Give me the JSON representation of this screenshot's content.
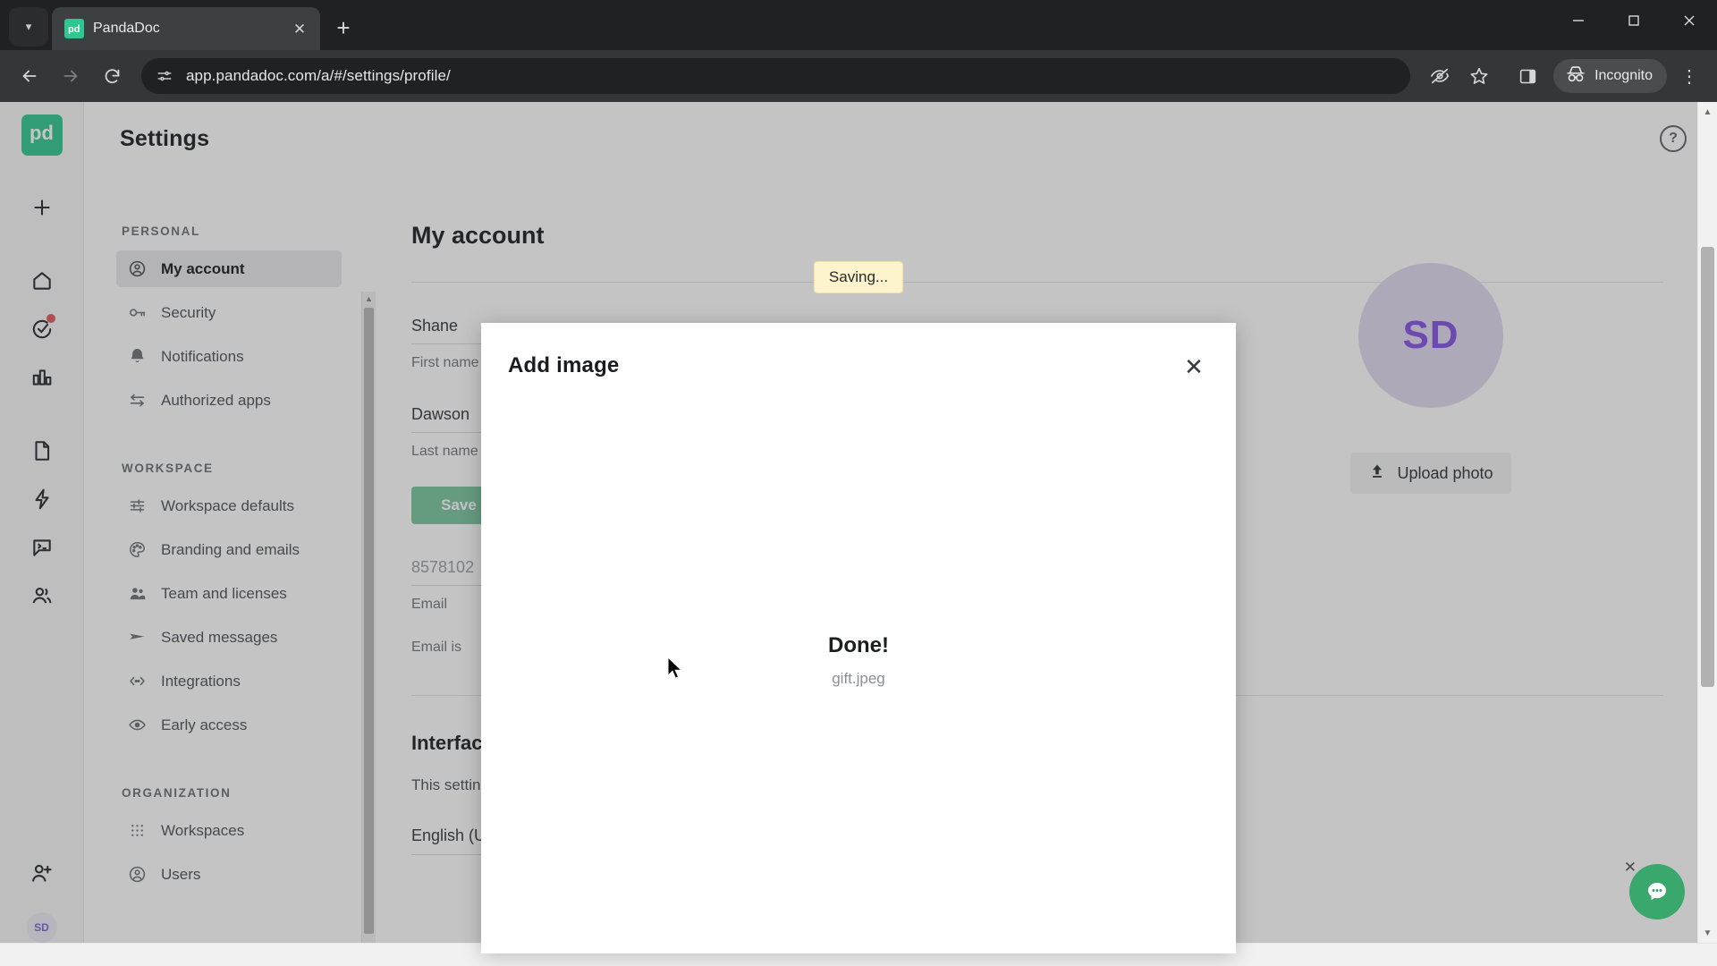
{
  "browser": {
    "tab": {
      "title": "PandaDoc",
      "favicon_label": "pd",
      "close_icon": "close-icon"
    },
    "new_tab_icon": "plus-icon",
    "tab_list_chevron_icon": "chevron-down-icon",
    "window_controls": {
      "minimize": "—",
      "maximize": "❐",
      "close": "✕"
    },
    "nav": {
      "back_icon": "arrow-left-icon",
      "forward_icon": "arrow-right-icon",
      "reload_icon": "reload-icon",
      "site_info_icon": "page-settings-icon"
    },
    "url": "app.pandadoc.com/a/#/settings/profile/",
    "actions": {
      "tracking_protection_icon": "eye-slash-icon",
      "bookmark_icon": "star-icon",
      "side_panel_icon": "side-panel-icon",
      "incognito_label": "Incognito",
      "incognito_icon": "incognito-icon",
      "menu_icon": "kebab-menu-icon"
    }
  },
  "rail": {
    "logo_label": "pd",
    "items": [
      {
        "name": "create-new",
        "icon": "plus-icon"
      },
      {
        "name": "home",
        "icon": "home-icon"
      },
      {
        "name": "tasks",
        "icon": "check-circle-icon",
        "badge": true
      },
      {
        "name": "reports",
        "icon": "bar-chart-icon"
      },
      {
        "name": "documents",
        "icon": "document-icon"
      },
      {
        "name": "quick-actions",
        "icon": "lightning-icon"
      },
      {
        "name": "forms",
        "icon": "form-icon"
      },
      {
        "name": "contacts",
        "icon": "people-icon"
      },
      {
        "name": "invite-users",
        "icon": "person-add-icon"
      }
    ],
    "avatar_initials": "SD"
  },
  "header": {
    "title": "Settings",
    "help_icon": "question-mark-icon",
    "help_label": "?"
  },
  "toast": {
    "text": "Saving..."
  },
  "sidebar": {
    "groups": [
      {
        "label": "PERSONAL",
        "items": [
          {
            "label": "My account",
            "icon": "user-circle-icon",
            "active": true
          },
          {
            "label": "Security",
            "icon": "key-icon",
            "active": false
          },
          {
            "label": "Notifications",
            "icon": "bell-icon",
            "active": false
          },
          {
            "label": "Authorized apps",
            "icon": "transfer-arrows-icon",
            "active": false
          }
        ]
      },
      {
        "label": "WORKSPACE",
        "items": [
          {
            "label": "Workspace defaults",
            "icon": "sliders-icon",
            "active": false
          },
          {
            "label": "Branding and emails",
            "icon": "palette-icon",
            "active": false
          },
          {
            "label": "Team and licenses",
            "icon": "people-icon",
            "active": false
          },
          {
            "label": "Saved messages",
            "icon": "send-icon",
            "active": false
          },
          {
            "label": "Integrations",
            "icon": "code-brackets-icon",
            "active": false
          },
          {
            "label": "Early access",
            "icon": "eye-icon",
            "active": false
          }
        ]
      },
      {
        "label": "ORGANIZATION",
        "items": [
          {
            "label": "Workspaces",
            "icon": "grid-dots-icon",
            "active": false
          },
          {
            "label": "Users",
            "icon": "user-circle-icon",
            "active": false
          }
        ]
      }
    ]
  },
  "main": {
    "page_title": "My account",
    "fields": [
      {
        "value": "Shane",
        "label": "First name"
      },
      {
        "value": "Dawson",
        "label": "Last name"
      }
    ],
    "save_label": "Save",
    "email": {
      "value": "8578102",
      "label": "Email"
    },
    "email_note": "Email is",
    "interface": {
      "heading": "Interface",
      "description": "This setting will update the display language.",
      "language": "English (United States)",
      "chevron_icon": "chevron-down-icon"
    },
    "avatar": {
      "initials": "SD",
      "upload_label": "Upload photo",
      "upload_icon": "upload-icon"
    }
  },
  "modal": {
    "title": "Add image",
    "close_icon": "close-icon",
    "done_title": "Done!",
    "file_name": "gift.jpeg"
  },
  "chat": {
    "icon": "chat-bubble-icon",
    "close_icon": "close-icon"
  },
  "colors": {
    "brand_green": "#2fc78f",
    "chat_green": "#3aa76d",
    "save_green": "#77c49c",
    "toast_yellow": "#fdf4cd",
    "avatar_purple": "#8152e2",
    "badge_red": "#e0575b"
  }
}
